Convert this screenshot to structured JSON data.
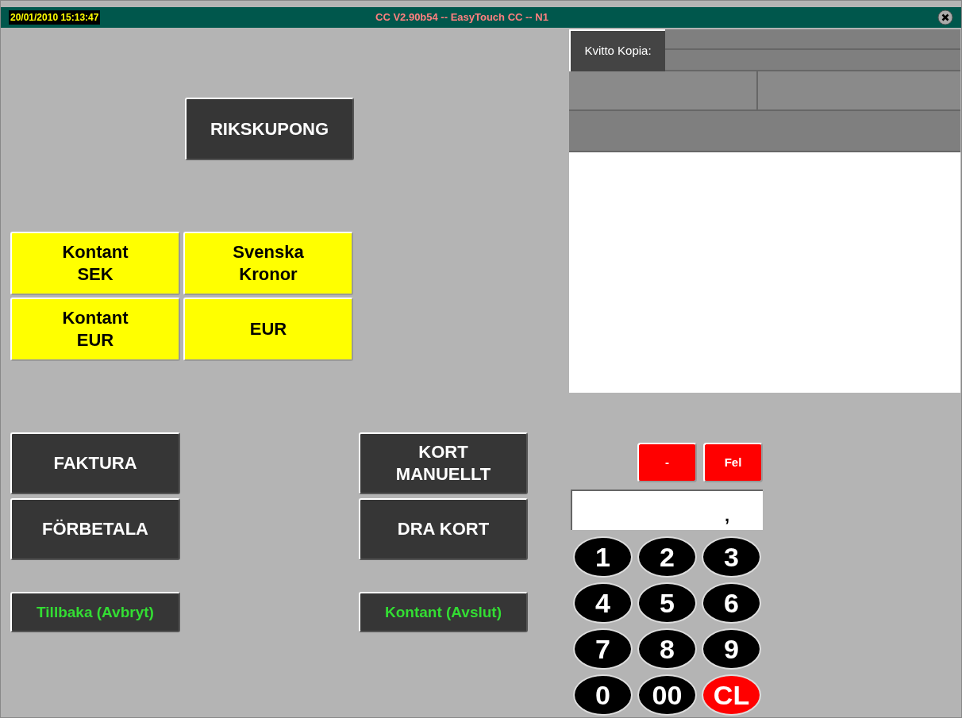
{
  "title_bar": {
    "datetime": "20/01/2010 15:13:47",
    "title": "CC V2.90b54 -- EasyTouch CC -- N1"
  },
  "coupon_button": {
    "label": "RIKSKUPONG",
    "kind": "dark"
  },
  "currency_buttons": [
    {
      "label": "Kontant\nSEK",
      "kind": "yellow"
    },
    {
      "label": "Svenska\nKronor",
      "kind": "yellow"
    },
    {
      "label": "Kontant\nEUR",
      "kind": "yellow"
    },
    {
      "label": "EUR",
      "kind": "yellow"
    }
  ],
  "payment_buttons": [
    {
      "label": "FAKTURA",
      "kind": "dark"
    },
    {
      "label": "FÖRBETALA",
      "kind": "dark"
    },
    {
      "label": "KORT\nMANUELLT",
      "kind": "dark"
    },
    {
      "label": "DRA KORT",
      "kind": "dark"
    }
  ],
  "action_buttons": [
    {
      "label": "Tillbaka (Avbryt)",
      "kind": "action"
    },
    {
      "label": "Kontant (Avslut)",
      "kind": "action"
    }
  ],
  "receipt": {
    "copy_button": "Kvitto Kopia:"
  },
  "keypad": {
    "function_keys": [
      "-",
      "Fel"
    ],
    "display": ",",
    "keys": [
      {
        "label": "1",
        "kind": "number"
      },
      {
        "label": "2",
        "kind": "number"
      },
      {
        "label": "3",
        "kind": "number"
      },
      {
        "label": "4",
        "kind": "number"
      },
      {
        "label": "5",
        "kind": "number"
      },
      {
        "label": "6",
        "kind": "number"
      },
      {
        "label": "7",
        "kind": "number"
      },
      {
        "label": "8",
        "kind": "number"
      },
      {
        "label": "9",
        "kind": "number"
      },
      {
        "label": "0",
        "kind": "number"
      },
      {
        "label": "00",
        "kind": "number"
      },
      {
        "label": "CL",
        "kind": "clear"
      }
    ]
  }
}
